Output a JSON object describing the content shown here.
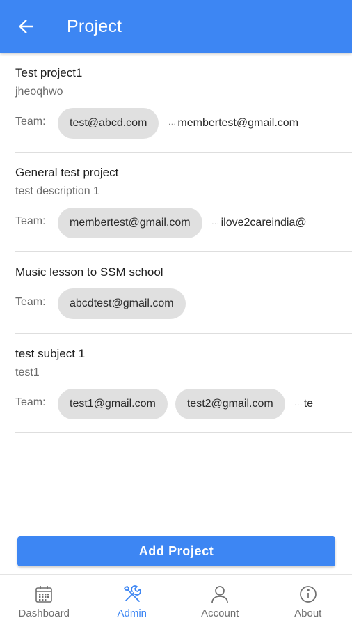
{
  "appbar": {
    "title": "Project",
    "back_icon": "arrow-left-icon",
    "color": "#3d86f3"
  },
  "projects": [
    {
      "name": "Test project1",
      "description": "jheoqhwo",
      "team_label": "Team:",
      "members": [
        "test@abcd.com"
      ],
      "overflow_member": "membertest@gmail.com"
    },
    {
      "name": "General test project",
      "description": "test description 1",
      "team_label": "Team:",
      "members": [
        "membertest@gmail.com"
      ],
      "overflow_member": "ilove2careindia@"
    },
    {
      "name": "Music lesson to SSM school",
      "description": "",
      "team_label": "Team:",
      "members": [
        "abcdtest@gmail.com"
      ],
      "overflow_member": ""
    },
    {
      "name": "test subject 1",
      "description": "test1",
      "team_label": "Team:",
      "members": [
        "test1@gmail.com",
        "test2@gmail.com"
      ],
      "overflow_member": "te"
    }
  ],
  "add_button": {
    "label": "Add Project"
  },
  "bottom_nav": [
    {
      "label": "Dashboard",
      "icon": "calendar-icon",
      "active": false
    },
    {
      "label": "Admin",
      "icon": "tools-icon",
      "active": true
    },
    {
      "label": "Account",
      "icon": "user-icon",
      "active": false
    },
    {
      "label": "About",
      "icon": "info-icon",
      "active": false
    }
  ]
}
